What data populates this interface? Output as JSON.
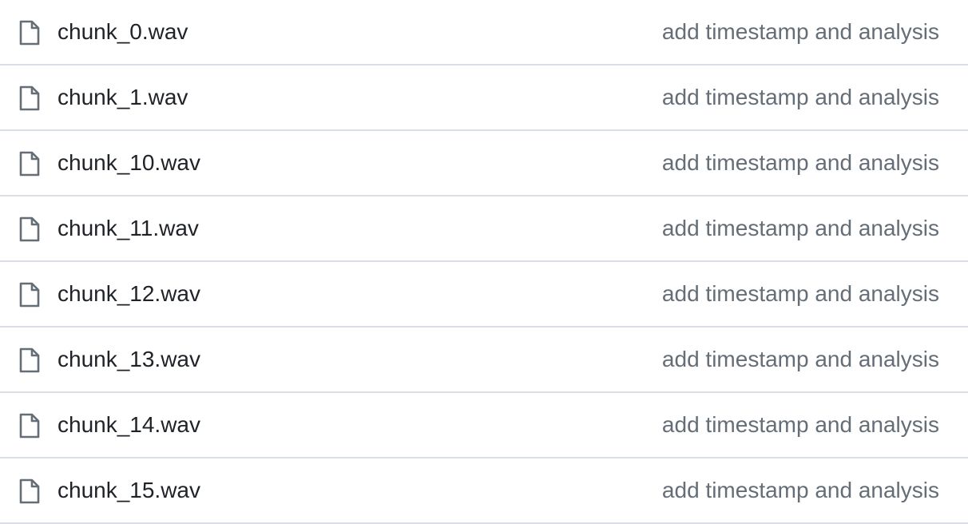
{
  "file_list": {
    "icon": "file-icon",
    "colors": {
      "file_name": "#1f2328",
      "commit_message": "#656d76",
      "icon": "#656d76",
      "divider": "#d8dee4"
    },
    "rows": [
      {
        "name": "chunk_0.wav",
        "commit_message": "add timestamp and analysis"
      },
      {
        "name": "chunk_1.wav",
        "commit_message": "add timestamp and analysis"
      },
      {
        "name": "chunk_10.wav",
        "commit_message": "add timestamp and analysis"
      },
      {
        "name": "chunk_11.wav",
        "commit_message": "add timestamp and analysis"
      },
      {
        "name": "chunk_12.wav",
        "commit_message": "add timestamp and analysis"
      },
      {
        "name": "chunk_13.wav",
        "commit_message": "add timestamp and analysis"
      },
      {
        "name": "chunk_14.wav",
        "commit_message": "add timestamp and analysis"
      },
      {
        "name": "chunk_15.wav",
        "commit_message": "add timestamp and analysis"
      }
    ]
  }
}
